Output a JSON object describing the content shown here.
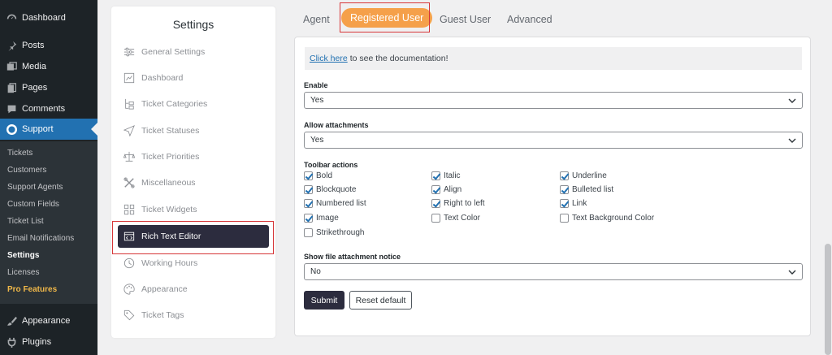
{
  "wp_menu": {
    "items": [
      {
        "label": "Dashboard",
        "icon": "dashboard-icon"
      },
      {
        "label": "Posts",
        "icon": "pin-icon"
      },
      {
        "label": "Media",
        "icon": "media-icon"
      },
      {
        "label": "Pages",
        "icon": "pages-icon"
      },
      {
        "label": "Comments",
        "icon": "comment-icon"
      },
      {
        "label": "Support",
        "icon": "lifebuoy-icon"
      }
    ],
    "submenu": [
      "Tickets",
      "Customers",
      "Support Agents",
      "Custom Fields",
      "Ticket List",
      "Email Notifications",
      "Settings",
      "Licenses",
      "Pro Features"
    ],
    "bottom_items": [
      {
        "label": "Appearance",
        "icon": "brush-icon"
      },
      {
        "label": "Plugins",
        "icon": "plugin-icon"
      }
    ],
    "accent": "#2271b1"
  },
  "settings": {
    "title": "Settings",
    "items": [
      {
        "label": "General Settings",
        "icon": "sliders-icon"
      },
      {
        "label": "Dashboard",
        "icon": "chart-icon"
      },
      {
        "label": "Ticket Categories",
        "icon": "tree-icon"
      },
      {
        "label": "Ticket Statuses",
        "icon": "send-icon"
      },
      {
        "label": "Ticket Priorities",
        "icon": "scale-icon"
      },
      {
        "label": "Miscellaneous",
        "icon": "tools-icon"
      },
      {
        "label": "Ticket Widgets",
        "icon": "widgets-icon"
      },
      {
        "label": "Rich Text Editor",
        "icon": "code-window-icon"
      },
      {
        "label": "Working Hours",
        "icon": "clock-icon"
      },
      {
        "label": "Appearance",
        "icon": "palette-icon"
      },
      {
        "label": "Ticket Tags",
        "icon": "tag-icon"
      }
    ]
  },
  "tabs": [
    "Agent",
    "Registered User",
    "Guest User",
    "Advanced"
  ],
  "form": {
    "doc_link": "Click here",
    "doc_text": "to see the documentation!",
    "enable_label": "Enable",
    "enable_value": "Yes",
    "attach_label": "Allow attachments",
    "attach_value": "Yes",
    "toolbar_label": "Toolbar actions",
    "toolbar": [
      {
        "label": "Bold",
        "checked": true
      },
      {
        "label": "Italic",
        "checked": true
      },
      {
        "label": "Underline",
        "checked": true
      },
      {
        "label": "Blockquote",
        "checked": true
      },
      {
        "label": "Align",
        "checked": true
      },
      {
        "label": "Bulleted list",
        "checked": true
      },
      {
        "label": "Numbered list",
        "checked": true
      },
      {
        "label": "Right to left",
        "checked": true
      },
      {
        "label": "Link",
        "checked": true
      },
      {
        "label": "Image",
        "checked": true
      },
      {
        "label": "Text Color",
        "checked": false
      },
      {
        "label": "Text Background Color",
        "checked": false
      },
      {
        "label": "Strikethrough",
        "checked": false
      }
    ],
    "notice_label": "Show file attachment notice",
    "notice_value": "No",
    "submit": "Submit",
    "reset": "Reset default"
  }
}
